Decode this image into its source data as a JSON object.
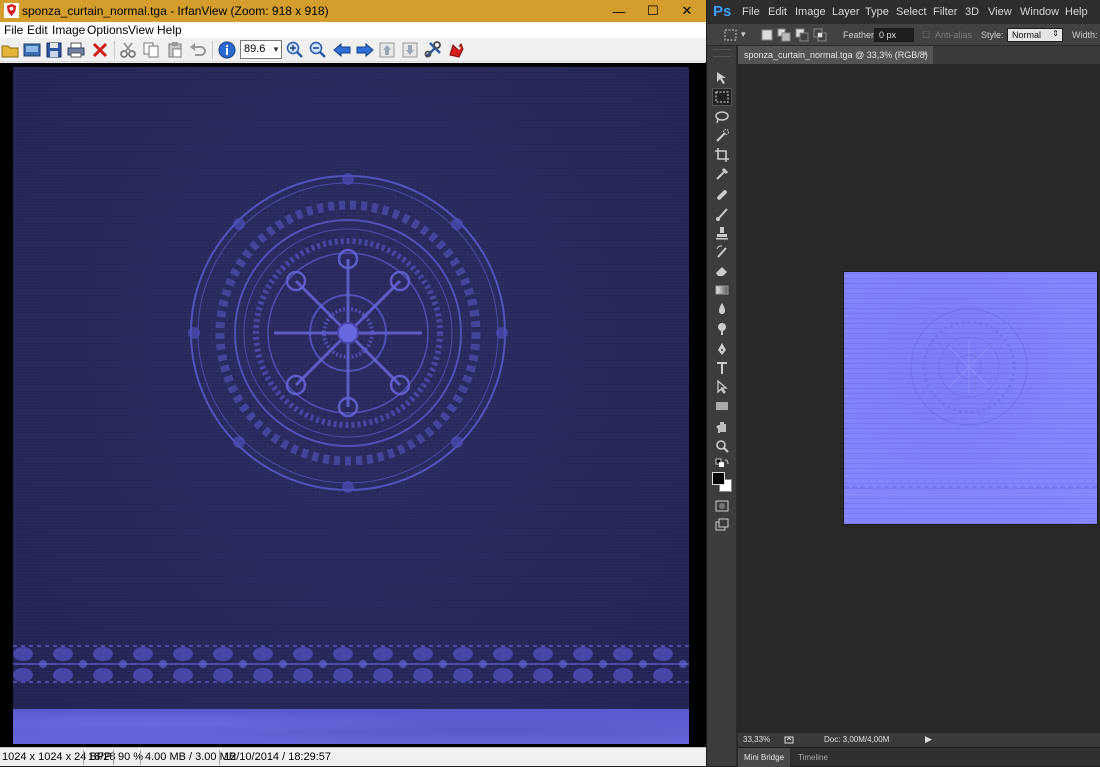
{
  "irfanview": {
    "title": "sponza_curtain_normal.tga - IrfanView (Zoom: 918 x 918)",
    "window_controls": {
      "minimize": "—",
      "maximize": "☐",
      "close": "✕"
    },
    "menu": [
      "File",
      "Edit",
      "Image",
      "Options",
      "View",
      "Help"
    ],
    "zoom_value": "89.6",
    "toolbar_icons": [
      "open-folder-icon",
      "slideshow-icon",
      "save-icon",
      "print-icon",
      "delete-icon",
      "cut-icon",
      "copy-icon",
      "paste-icon",
      "undo-icon",
      "info-icon",
      "zoom-in-icon",
      "zoom-out-icon",
      "previous-icon",
      "next-icon",
      "page-up-icon",
      "page-down-icon",
      "settings-icon",
      "exit-icon"
    ],
    "status": {
      "dimensions": "1024 x 1024 x 24 BPP",
      "index": "18/28",
      "zoom": "90 %",
      "size": "4.00 MB / 3.00 MB",
      "datetime": "12/10/2014 / 18:29:57"
    },
    "colors": {
      "titlebar": "#d39e2c",
      "image_base": "#27285a",
      "pattern": "#5b5acb",
      "band": "#6462d6"
    }
  },
  "photoshop": {
    "logo": "Ps",
    "menu": [
      "File",
      "Edit",
      "Image",
      "Layer",
      "Type",
      "Select",
      "Filter",
      "3D",
      "View",
      "Window",
      "Help"
    ],
    "options": {
      "feather_label": "Feather:",
      "feather_value": "0 px",
      "antialias_label": "Anti-alias",
      "style_label": "Style:",
      "style_value": "Normal",
      "width_label": "Width:"
    },
    "document_tab": "sponza_curtain_normal.tga @ 33,3% (RGB/8)",
    "status": {
      "zoom": "33,33%",
      "doc": "Doc: 3,00M/4,00M"
    },
    "panel_tabs": [
      "Mini Bridge",
      "Timeline"
    ],
    "tools": [
      "move-icon",
      "marquee-icon",
      "lasso-icon",
      "quick-select-icon",
      "crop-icon",
      "eyedropper-icon",
      "healing-icon",
      "brush-icon",
      "clone-stamp-icon",
      "history-brush-icon",
      "eraser-icon",
      "gradient-icon",
      "blur-icon",
      "dodge-icon",
      "pen-icon",
      "type-icon",
      "path-select-icon",
      "rectangle-icon",
      "hand-icon",
      "zoom-icon",
      "swap-colors-icon",
      "color-swatches-icon",
      "quick-mask-icon",
      "screen-mode-icon"
    ],
    "colors": {
      "accent": "#3ba0ff",
      "normal_map": "#8486fd",
      "background": "#282828"
    }
  }
}
